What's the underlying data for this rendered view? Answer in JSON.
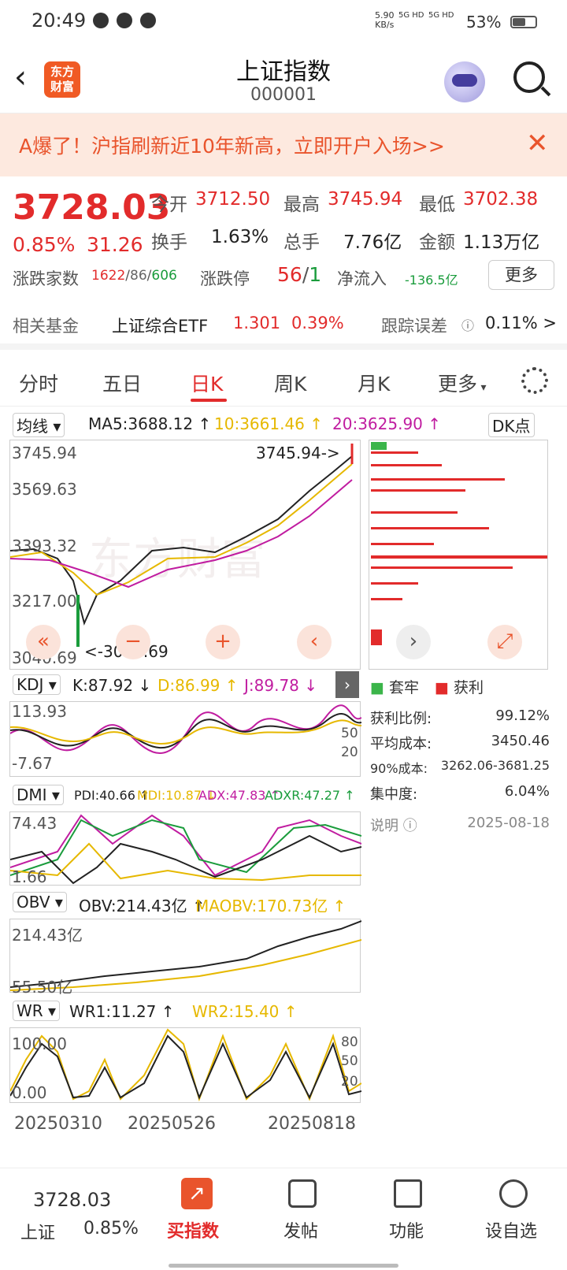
{
  "status": {
    "time": "20:49",
    "net_speed": "5.90",
    "net_unit": "KB/s",
    "sig1": "5G HD",
    "sig2": "5G HD",
    "battery": "53%"
  },
  "header": {
    "title": "上证指数",
    "code": "000001",
    "logo_line1": "东方",
    "logo_line2": "财富"
  },
  "banner": {
    "text": "A爆了！沪指刷新近10年新高，立即开户入场>>"
  },
  "quote": {
    "price": "3728.03",
    "pct": "0.85%",
    "change": "31.26",
    "open_label": "今开",
    "open": "3712.50",
    "high_label": "最高",
    "high": "3745.94",
    "low_label": "最低",
    "low": "3702.38",
    "turnover_label": "换手",
    "turnover": "1.63%",
    "volume_label": "总手",
    "volume": "7.76亿",
    "amount_label": "金额",
    "amount": "1.13万亿",
    "breadth_label": "涨跌家数",
    "breadth_up": "1622",
    "breadth_flat": "86",
    "breadth_down": "606",
    "limit_label": "涨跌停",
    "limit_up": "56",
    "limit_down": "1",
    "inflow_label": "净流入",
    "inflow": "-136.5亿",
    "more": "更多",
    "fund_label": "相关基金",
    "fund_name": "上证综合ETF",
    "fund_price": "1.301",
    "fund_pct": "0.39%",
    "track_label": "跟踪误差",
    "track_val": "0.11% >"
  },
  "tabs": [
    "分时",
    "五日",
    "日K",
    "周K",
    "月K",
    "更多"
  ],
  "ma": {
    "selector": "均线",
    "ma5": "MA5:3688.12 ↑",
    "ma10": "10:3661.46 ↑",
    "ma20": "20:3625.90 ↑",
    "dk": "DK点"
  },
  "kline": {
    "y_labels": [
      "3745.94",
      "3569.63",
      "3393.32",
      "3217.00",
      "3040.69"
    ],
    "high_note": "3745.94->",
    "low_note": "<-3040.69",
    "watermark": "东方财富"
  },
  "kdj": {
    "selector": "KDJ",
    "k": "K:87.92 ↓",
    "d": "D:86.99 ↑",
    "j": "J:89.78 ↓",
    "top": "113.93",
    "bottom": "-7.67",
    "r50": "50",
    "r20": "20"
  },
  "dmi": {
    "selector": "DMI",
    "pdi": "PDI:40.66 ↑",
    "mdi": "MDI:10.87 ↓",
    "adx": "ADX:47.83 ↑",
    "adxr": "ADXR:47.27 ↑",
    "top": "74.43",
    "bottom": "1.66"
  },
  "obv": {
    "selector": "OBV",
    "obv": "OBV:214.43亿 ↑",
    "maobv": "MAOBV:170.73亿 ↑",
    "top": "214.43亿",
    "bottom": "55.50亿"
  },
  "wr": {
    "selector": "WR",
    "wr1": "WR1:11.27 ↑",
    "wr2": "WR2:15.40 ↑",
    "top": "100.00",
    "bottom": "0.00",
    "r80": "80",
    "r50": "50",
    "r20": "20"
  },
  "dates": [
    "20250310",
    "20250526",
    "20250818"
  ],
  "chips": {
    "legend1": "套牢",
    "legend2": "获利",
    "profit_ratio_label": "获利比例:",
    "profit_ratio": "99.12%",
    "avg_cost_label": "平均成本:",
    "avg_cost": "3450.46",
    "cost90_label": "90%成本:",
    "cost90": "3262.06-3681.25",
    "concentration_label": "集中度:",
    "concentration": "6.04%",
    "note_label": "说明",
    "date": "2025-08-18"
  },
  "bottom": {
    "price": "3728.03",
    "name": "上证",
    "pct": "0.85%",
    "buy": "买指数",
    "post": "发帖",
    "func": "功能",
    "watch": "设自选"
  },
  "colors": {
    "red": "#e22b2b",
    "green": "#1a9c3c",
    "orange": "#e9542c",
    "ma10": "#e6b800",
    "ma20": "#c01ca0"
  }
}
